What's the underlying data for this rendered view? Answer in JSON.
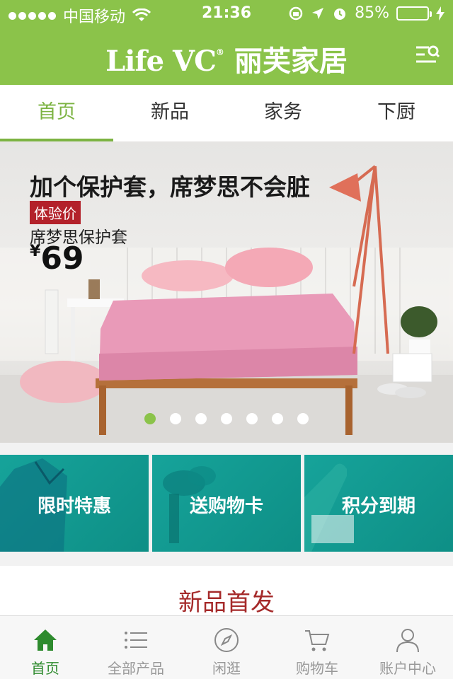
{
  "status_bar": {
    "carrier": "中国移动",
    "time": "21:36",
    "battery": "85%",
    "battery_level": 0.85
  },
  "header": {
    "brand_en": "Life VC",
    "brand_mark": "®",
    "brand_cn": "丽芙家居",
    "menu_icon": "search-menu-icon"
  },
  "tabs": [
    {
      "label": "首页",
      "active": true
    },
    {
      "label": "新品",
      "active": false
    },
    {
      "label": "家务",
      "active": false
    },
    {
      "label": "下厨",
      "active": false
    }
  ],
  "banner": {
    "headline": "加个保护套，席梦思不会脏",
    "tag": "体验价",
    "subtitle": "席梦思保护套",
    "currency": "¥",
    "price": "69",
    "slide_count": 7,
    "active_slide": 1
  },
  "promos": [
    {
      "label": "限时特惠"
    },
    {
      "label": "送购物卡"
    },
    {
      "label": "积分到期"
    }
  ],
  "section": {
    "title": "新品首发"
  },
  "bottom_nav": [
    {
      "label": "首页",
      "icon": "home-icon",
      "active": true
    },
    {
      "label": "全部产品",
      "icon": "list-icon",
      "active": false
    },
    {
      "label": "闲逛",
      "icon": "compass-icon",
      "active": false
    },
    {
      "label": "购物车",
      "icon": "cart-icon",
      "active": false
    },
    {
      "label": "账户中心",
      "icon": "user-icon",
      "active": false
    }
  ],
  "colors": {
    "brand_green": "#8bc34a",
    "active_tab": "#7cb342",
    "teal_tile": "#16a39a",
    "section_title": "#a52a2a",
    "tag_red": "#b3212a"
  }
}
